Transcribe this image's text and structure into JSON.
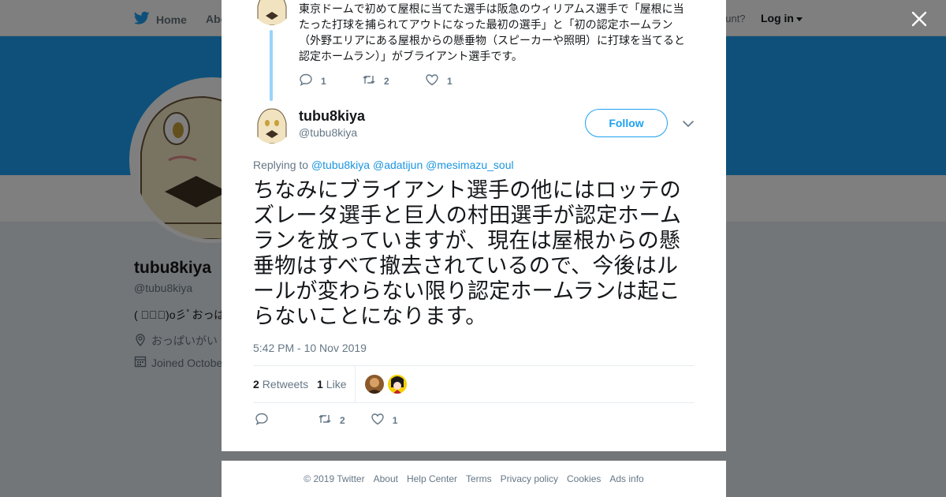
{
  "nav": {
    "home_label": "Home",
    "about_label": "Abo",
    "account_prompt": "ccount?",
    "login_label": "Log in"
  },
  "profile": {
    "name": "tubu8kiya",
    "handle": "@tubu8kiya",
    "bio": "( ﾟ∀ﾟ)o彡ﾟおっぱ",
    "location": "おっぱいがい",
    "joined": "Joined Octobe"
  },
  "thread": {
    "previous_tweet": {
      "text": "東京ドームで初めて屋根に当てた選手は阪急のウィリアムス選手で「屋根に当たった打球を捕られてアウトになった最初の選手」と「初の認定ホームラン（外野エリアにある屋根からの懸垂物（スピーカーや照明）に打球を当てると認定ホームラン）」がブライアント選手です。",
      "reply_count": "1",
      "retweet_count": "2",
      "like_count": "1"
    },
    "tweet": {
      "author_name": "tubu8kiya",
      "author_handle": "@tubu8kiya",
      "follow_label": "Follow",
      "replying_prefix": "Replying to",
      "mentions": [
        "@tubu8kiya",
        "@adatijun",
        "@mesimazu_soul"
      ],
      "text": "ちなみにブライアント選手の他にはロッテのズレータ選手と巨人の村田選手が認定ホームランを放っていますが、現在は屋根からの懸垂物はすべて撤去されているので、今後はルールが変わらない限り認定ホームランは起こらないことになります。",
      "timestamp": "5:42 PM - 10 Nov 2019",
      "retweets_count": "2",
      "retweets_label": "Retweets",
      "likes_count": "1",
      "likes_label": "Like",
      "retweet_count_action": "2",
      "like_count_action": "1"
    }
  },
  "footer": {
    "links": [
      "© 2019 Twitter",
      "About",
      "Help Center",
      "Terms",
      "Privacy policy",
      "Cookies",
      "Ads info"
    ]
  },
  "colors": {
    "brand_blue": "#1da1f2",
    "thread_line": "#9ad3f8",
    "mention": "#1b95e0",
    "secondary_text": "#657786"
  },
  "icons": {
    "nav_home": "twitter-bird-icon",
    "close": "close-icon",
    "reply": "reply-icon",
    "retweet": "retweet-icon",
    "like": "heart-icon",
    "more": "chevron-down-icon",
    "location": "location-pin-icon",
    "calendar": "calendar-icon"
  }
}
